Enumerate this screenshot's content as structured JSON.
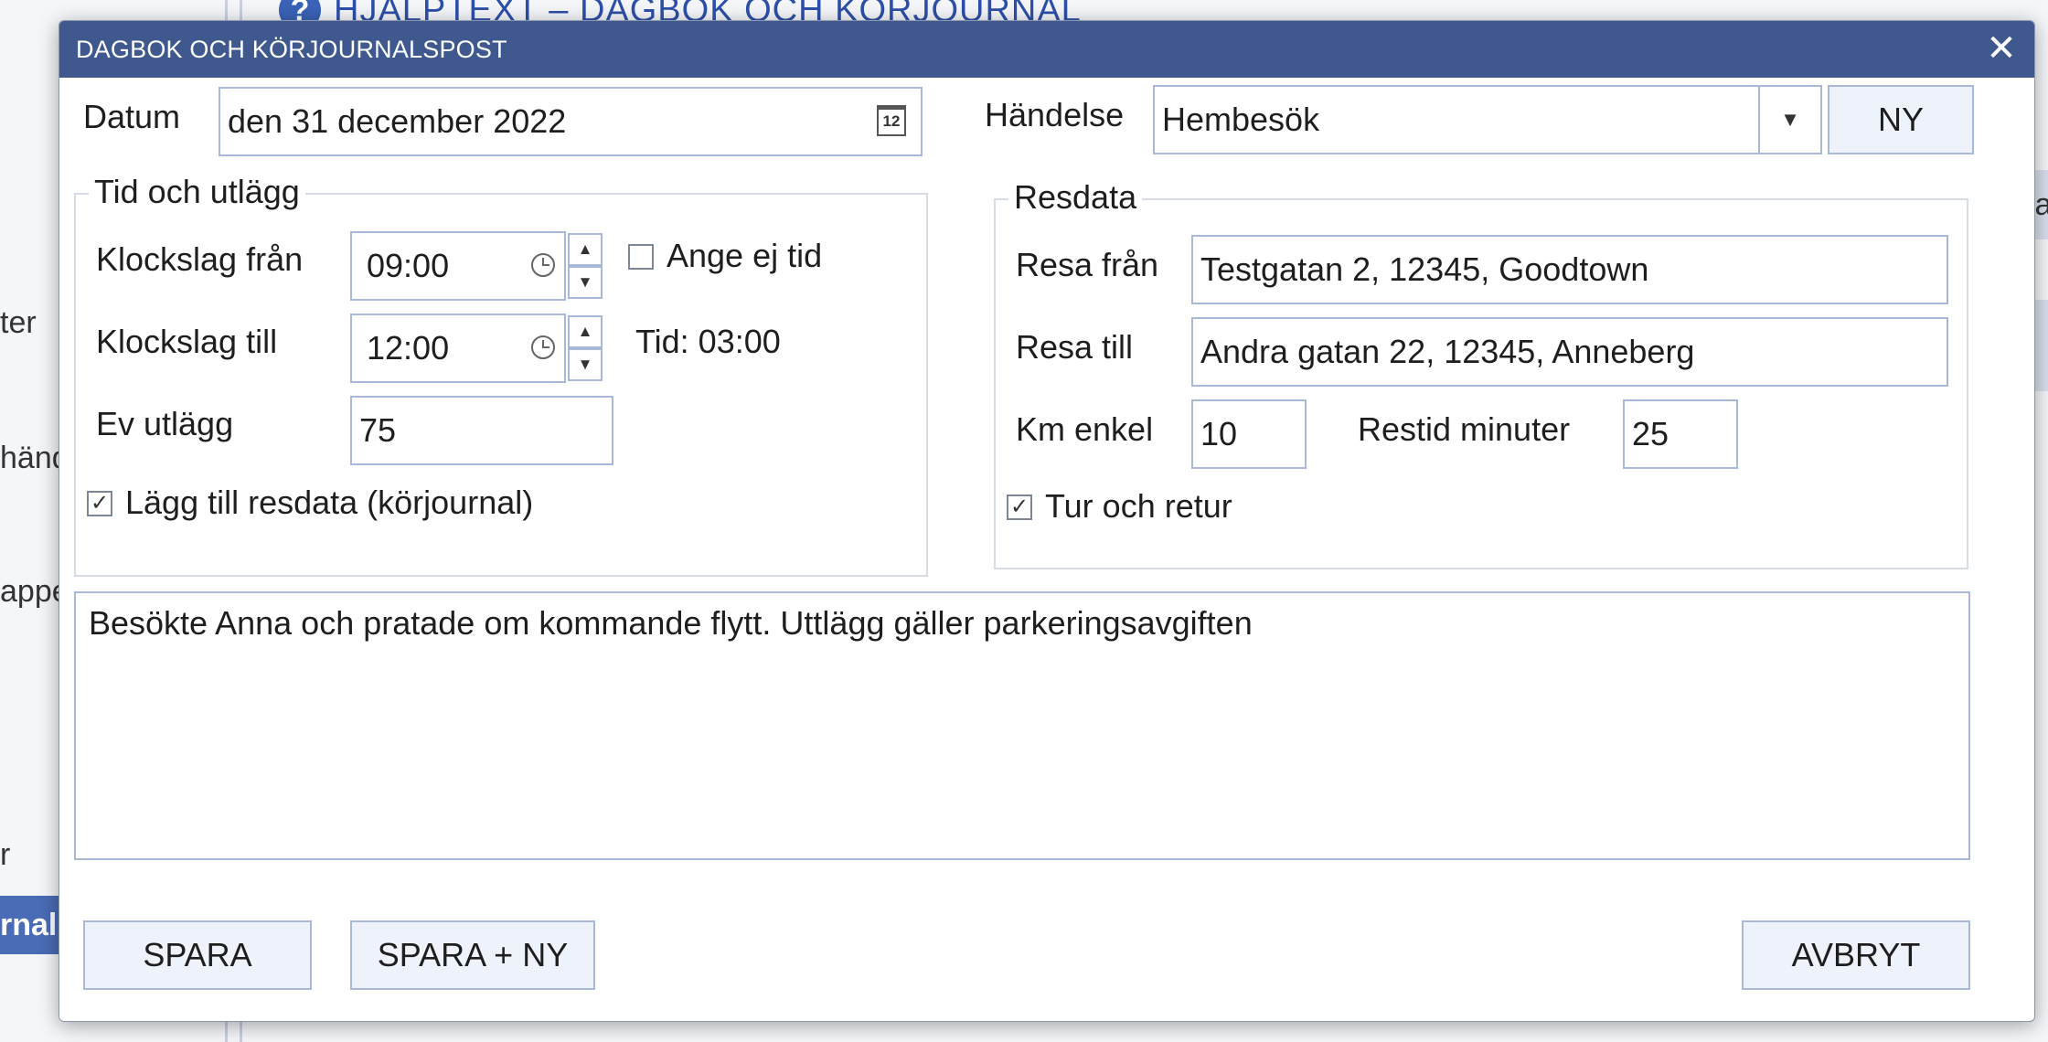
{
  "background": {
    "help_header": "HJÄLPTEXT – DAGBOK OCH KÖRJOURNAL",
    "sidebar_fragments": [
      "ter",
      "händ",
      "appe",
      "r",
      "rnal"
    ],
    "right_tab_fragment": "la"
  },
  "dialog": {
    "title": "DAGBOK OCH KÖRJOURNALSPOST",
    "close_glyph": "✕",
    "datum": {
      "label": "Datum",
      "value": "den 31 december 2022",
      "calendar_day": "12"
    },
    "handelse": {
      "label": "Händelse",
      "value": "Hembesök",
      "new_button": "NY"
    },
    "tid_group": {
      "legend": "Tid och utlägg",
      "from_label": "Klockslag från",
      "from_value": "09:00",
      "to_label": "Klockslag till",
      "to_value": "12:00",
      "no_time_label": "Ange ej tid",
      "no_time_checked": false,
      "duration_text": "Tid: 03:00",
      "expense_label": "Ev utlägg",
      "expense_value": "75",
      "add_travel_label": "Lägg till resdata (körjournal)",
      "add_travel_checked": true
    },
    "resdata_group": {
      "legend": "Resdata",
      "from_label": "Resa från",
      "from_value": "Testgatan 2, 12345, Goodtown",
      "to_label": "Resa till",
      "to_value": "Andra gatan 22, 12345, Anneberg",
      "km_label": "Km enkel",
      "km_value": "10",
      "traveltime_label": "Restid minuter",
      "traveltime_value": "25",
      "roundtrip_label": "Tur och retur",
      "roundtrip_checked": true
    },
    "notes": "Besökte Anna och pratade om kommande flytt. Uttlägg gäller parkeringsavgiften",
    "buttons": {
      "save": "SPARA",
      "save_new": "SPARA + NY",
      "cancel": "AVBRYT"
    },
    "glyphs": {
      "check": "✓",
      "up": "▲",
      "down": "▼"
    }
  },
  "colors": {
    "titlebar": "#3f598f",
    "field_border": "#a9b8d6",
    "button_bg": "#eef2fa"
  }
}
